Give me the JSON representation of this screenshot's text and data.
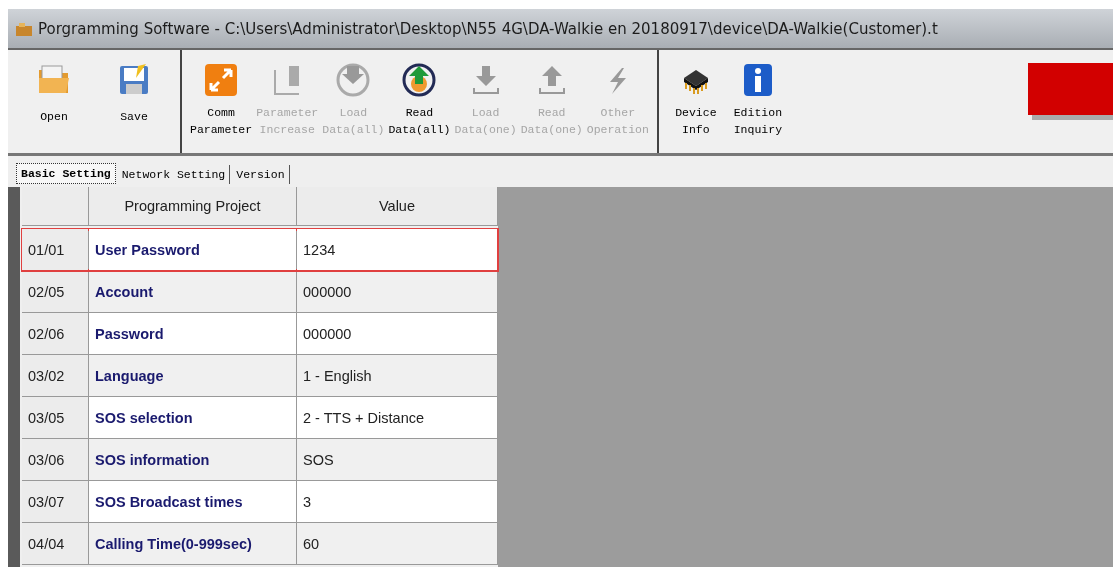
{
  "window": {
    "title": "Porgramming Software - C:\\Users\\Administrator\\Desktop\\N55 4G\\DA-Walkie en 20180917\\device\\DA-Walkie(Customer).t"
  },
  "toolbar": {
    "groups": [
      [
        {
          "line1": "Open",
          "disabled": false
        },
        {
          "line1": "Save",
          "disabled": false
        }
      ],
      [
        {
          "line1": "Comm",
          "line2": "Parameter",
          "disabled": false
        },
        {
          "line1": "Parameter",
          "line2": "Increase",
          "disabled": true
        },
        {
          "line1": "Load",
          "line2": "Data(all)",
          "disabled": true
        },
        {
          "line1": "Read",
          "line2": "Data(all)",
          "disabled": false
        },
        {
          "line1": "Load",
          "line2": "Data(one)",
          "disabled": true
        },
        {
          "line1": "Read",
          "line2": "Data(one)",
          "disabled": true
        },
        {
          "line1": "Other",
          "line2": "Operation",
          "disabled": true
        }
      ],
      [
        {
          "line1": "Device",
          "line2": "Info",
          "disabled": false
        },
        {
          "line1": "Edition",
          "line2": "Inquiry",
          "disabled": false
        }
      ]
    ]
  },
  "tabs": [
    {
      "label": "Basic Setting",
      "selected": true
    },
    {
      "label": "Network Setting",
      "selected": false
    },
    {
      "label": "Version",
      "selected": false
    }
  ],
  "table": {
    "columns": [
      "Programming Project",
      "Value"
    ],
    "rows": [
      {
        "code": "01/01",
        "project": "User Password",
        "value": "1234",
        "highlighted": true
      },
      {
        "code": "02/05",
        "project": "Account",
        "value": "000000",
        "highlighted": false
      },
      {
        "code": "02/06",
        "project": "Password",
        "value": "000000",
        "highlighted": false
      },
      {
        "code": "03/02",
        "project": "Language",
        "value": "1 - English",
        "highlighted": false
      },
      {
        "code": "03/05",
        "project": "SOS selection",
        "value": "2 - TTS + Distance",
        "highlighted": false
      },
      {
        "code": "03/06",
        "project": "SOS information",
        "value": "SOS",
        "highlighted": false
      },
      {
        "code": "03/07",
        "project": "SOS Broadcast times",
        "value": "3",
        "highlighted": false
      },
      {
        "code": "04/04",
        "project": "Calling Time(0-999sec)",
        "value": "60",
        "highlighted": false
      }
    ]
  }
}
